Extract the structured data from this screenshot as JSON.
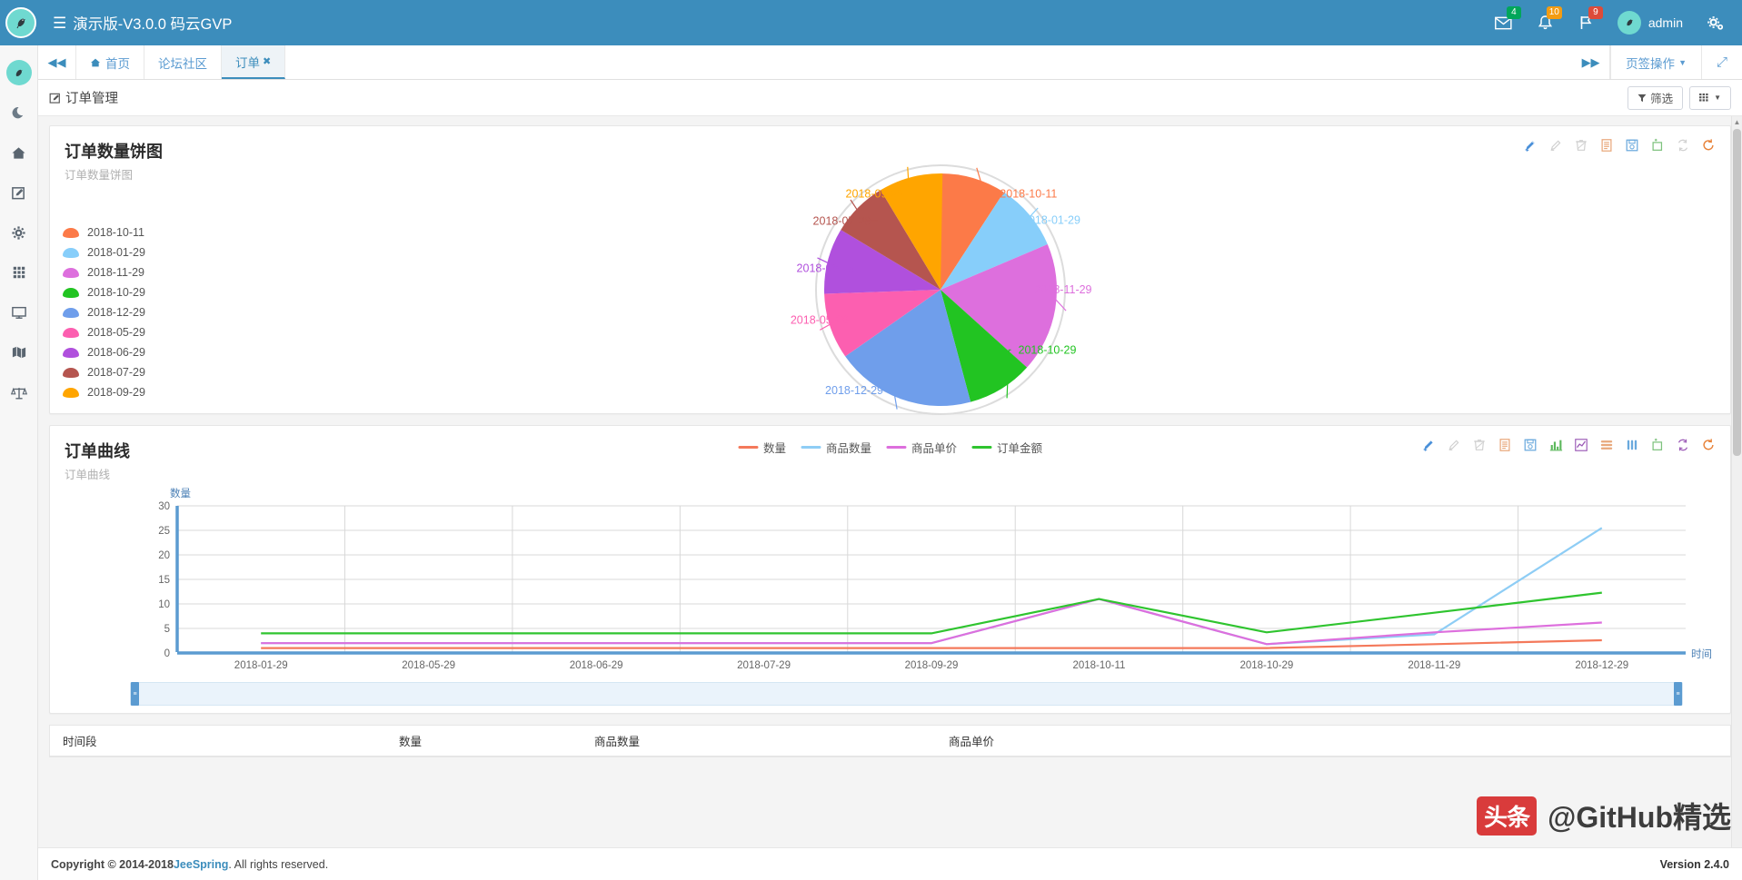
{
  "header": {
    "brand": "演示版-V3.0.0 码云GVP",
    "hamburger": "☰",
    "mail_badge": "4",
    "bell_badge": "10",
    "flag_badge": "9",
    "username": "admin",
    "accent": "#3c8dbc"
  },
  "sidebar": {
    "items": [
      {
        "name": "logo",
        "glyph": "🐦"
      },
      {
        "name": "moon",
        "glyph": "☾"
      },
      {
        "name": "home",
        "glyph": "⌂"
      },
      {
        "name": "edit",
        "glyph": "✎"
      },
      {
        "name": "settings",
        "glyph": "✿"
      },
      {
        "name": "apps",
        "glyph": "⠿"
      },
      {
        "name": "monitor",
        "glyph": "▭"
      },
      {
        "name": "map",
        "glyph": "▦"
      },
      {
        "name": "balance",
        "glyph": "⚖"
      }
    ]
  },
  "tabs": {
    "collapse_label": "◀◀",
    "expand_label": "▶▶",
    "items": [
      {
        "label": "首页",
        "icon": "⌂",
        "closable": false,
        "active": false
      },
      {
        "label": "论坛社区",
        "icon": "",
        "closable": false,
        "active": false
      },
      {
        "label": "订单",
        "icon": "",
        "closable": true,
        "active": true
      }
    ],
    "operations_label": "页签操作",
    "fullscreen_label": "⤢"
  },
  "page": {
    "title": "订单管理",
    "filter_button": "筛选",
    "columns_button": "▦"
  },
  "pie_panel": {
    "title": "订单数量饼图",
    "subtitle": "订单数量饼图",
    "tools": [
      {
        "name": "add-icon",
        "glyph": "✐",
        "color": "#4a90d9"
      },
      {
        "name": "edit-icon",
        "glyph": "✎",
        "color": "#cfcfcf"
      },
      {
        "name": "delete-icon",
        "glyph": "🗑",
        "color": "#cfcfcf"
      },
      {
        "name": "report-icon",
        "glyph": "▤",
        "color": "#e8a87c"
      },
      {
        "name": "save-icon",
        "glyph": "💾",
        "color": "#6aa9dd"
      },
      {
        "name": "crop-icon",
        "glyph": "⇲",
        "color": "#7ec27e"
      },
      {
        "name": "swap-icon",
        "glyph": "⇄",
        "color": "#d0d0d0"
      },
      {
        "name": "refresh-icon",
        "glyph": "↻",
        "color": "#e8833a"
      }
    ]
  },
  "line_panel": {
    "title": "订单曲线",
    "subtitle": "订单曲线",
    "tools": [
      {
        "name": "add-icon",
        "glyph": "✐",
        "color": "#4a90d9"
      },
      {
        "name": "edit-icon",
        "glyph": "✎",
        "color": "#cfcfcf"
      },
      {
        "name": "delete-icon",
        "glyph": "🗑",
        "color": "#cfcfcf"
      },
      {
        "name": "report-icon",
        "glyph": "▤",
        "color": "#e8a87c"
      },
      {
        "name": "save-icon",
        "glyph": "💾",
        "color": "#6aa9dd"
      },
      {
        "name": "bar-chart-icon",
        "glyph": "▊",
        "color": "#5cb85c"
      },
      {
        "name": "line-chart-icon",
        "glyph": "📈",
        "color": "#9b59b6"
      },
      {
        "name": "stacked-bar-icon",
        "glyph": "☰",
        "color": "#e8a87c"
      },
      {
        "name": "column-chart-icon",
        "glyph": "|||",
        "color": "#6aa9dd"
      },
      {
        "name": "crop-icon",
        "glyph": "⇲",
        "color": "#7ec27e"
      },
      {
        "name": "swap-icon",
        "glyph": "⇄",
        "color": "#9b59b6"
      },
      {
        "name": "refresh-icon",
        "glyph": "↻",
        "color": "#e8833a"
      }
    ]
  },
  "table": {
    "headers": [
      "时间段",
      "数量",
      "商品数量",
      "商品单价"
    ]
  },
  "watermark": {
    "badge": "头条",
    "text": "@GitHub精选"
  },
  "footer": {
    "copyright_prefix": "Copyright © 2014-2018 ",
    "link": "JeeSpring",
    "copyright_suffix": ". All rights reserved.",
    "version": "Version 2.4.0"
  },
  "chart_data": [
    {
      "type": "pie",
      "title": "订单数量饼图",
      "legend_position": "left",
      "labels": [
        "2018-10-11",
        "2018-01-29",
        "2018-11-29",
        "2018-10-29",
        "2018-12-29",
        "2018-05-29",
        "2018-06-29",
        "2018-07-29",
        "2018-09-29"
      ],
      "colors": [
        "#fc7a48",
        "#87cefa",
        "#dd6fdd",
        "#22c422",
        "#6f9eeb",
        "#fc5fb0",
        "#b050dd",
        "#b5554f",
        "#ffa500"
      ],
      "values": [
        9.2,
        9.4,
        18.1,
        9.2,
        19.4,
        9.2,
        9.2,
        7.8,
        8.9
      ],
      "angles_deg": [
        33,
        34,
        65,
        33,
        70,
        33,
        33,
        28,
        32
      ]
    },
    {
      "type": "line",
      "title": "订单曲线",
      "xlabel": "时间",
      "ylabel": "数量",
      "ylim": [
        0,
        30
      ],
      "yticks": [
        0,
        5,
        10,
        15,
        20,
        25,
        30
      ],
      "grid": true,
      "legend_position": "top",
      "categories": [
        "2018-01-29",
        "2018-05-29",
        "2018-06-29",
        "2018-07-29",
        "2018-09-29",
        "2018-10-11",
        "2018-10-29",
        "2018-11-29",
        "2018-12-29"
      ],
      "series": [
        {
          "name": "数量",
          "color": "#f4795b",
          "values": [
            1,
            1,
            1,
            1,
            1,
            1,
            1,
            1.8,
            2.6
          ]
        },
        {
          "name": "商品数量",
          "color": "#8ecdf5",
          "values": [
            2,
            2,
            2,
            2,
            2,
            11,
            1.8,
            3.8,
            25.5
          ]
        },
        {
          "name": "商品单价",
          "color": "#dd6fdd",
          "values": [
            2,
            2,
            2,
            2,
            2,
            11,
            1.8,
            4.2,
            6.2
          ]
        },
        {
          "name": "订单金额",
          "color": "#2fc42f",
          "values": [
            4,
            4,
            4,
            4,
            4,
            11,
            4.2,
            8.2,
            12.3
          ]
        }
      ]
    }
  ]
}
